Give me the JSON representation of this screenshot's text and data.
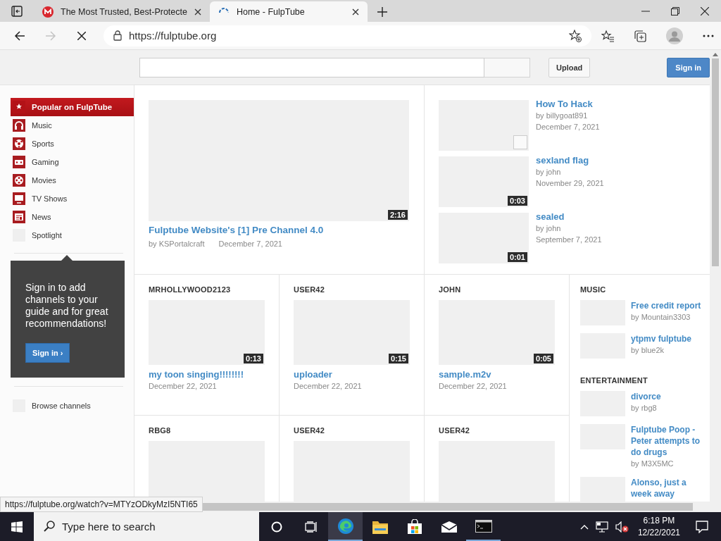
{
  "browser": {
    "tabs": [
      {
        "title": "The Most Trusted, Best-Protecte",
        "selected": false
      },
      {
        "title": "Home - FulpTube",
        "selected": true
      }
    ],
    "address": "https://fulptube.org"
  },
  "header": {
    "upload": "Upload",
    "sign_in": "Sign in"
  },
  "guide": {
    "items": [
      {
        "label": "Popular on FulpTube",
        "selected": true
      },
      {
        "label": "Music",
        "selected": false
      },
      {
        "label": "Sports",
        "selected": false
      },
      {
        "label": "Gaming",
        "selected": false
      },
      {
        "label": "Movies",
        "selected": false
      },
      {
        "label": "TV Shows",
        "selected": false
      },
      {
        "label": "News",
        "selected": false
      },
      {
        "label": "Spotlight",
        "selected": false
      }
    ],
    "promo": {
      "text": "Sign in to add channels to your guide and for great recommendations!",
      "button": "Sign in ›"
    },
    "browse": "Browse channels"
  },
  "featured": {
    "title": "Fulptube Website's [1] Pre Channel 4.0",
    "author": "by KSPortalcraft",
    "date": "December 7, 2021",
    "duration": "2:16"
  },
  "side_videos": [
    {
      "title": "How To Hack",
      "author": "by billygoat891",
      "date": "December 7, 2021"
    },
    {
      "title": "sexland flag",
      "author": "by john",
      "date": "November 29, 2021",
      "duration": "0:03"
    },
    {
      "title": "sealed",
      "author": "by john",
      "date": "September 7, 2021",
      "duration": "0:01"
    }
  ],
  "feed": [
    {
      "channel": "MRHOLLYWOOD2123",
      "title": "my toon singing!!!!!!!!",
      "date": "December 22, 2021",
      "duration": "0:13"
    },
    {
      "channel": "USER42",
      "title": "uploader",
      "date": "December 22, 2021",
      "duration": "0:15"
    },
    {
      "channel": "JOHN",
      "title": "sample.m2v",
      "date": "December 22, 2021",
      "duration": "0:05"
    },
    {
      "channel": "RBG8"
    },
    {
      "channel": "USER42"
    },
    {
      "channel": "USER42"
    }
  ],
  "categories": [
    {
      "heading": "MUSIC",
      "videos": [
        {
          "title": "Free credit report",
          "author": "by Mountain3303"
        },
        {
          "title": "ytpmv fulptube",
          "author": "by blue2k"
        }
      ]
    },
    {
      "heading": "ENTERTAINMENT",
      "videos": [
        {
          "title": "divorce",
          "author": "by rbg8"
        },
        {
          "title": "Fulptube Poop - Peter attempts to do drugs",
          "author": "by M3X5MC"
        },
        {
          "title": "Alonso, just a week away"
        }
      ]
    }
  ],
  "status_url": "https://fulptube.org/watch?v=MTYzODkyMzI5NTI65",
  "taskbar": {
    "search_placeholder": "Type here to search",
    "time": "6:18 PM",
    "date": "12/22/2021"
  }
}
